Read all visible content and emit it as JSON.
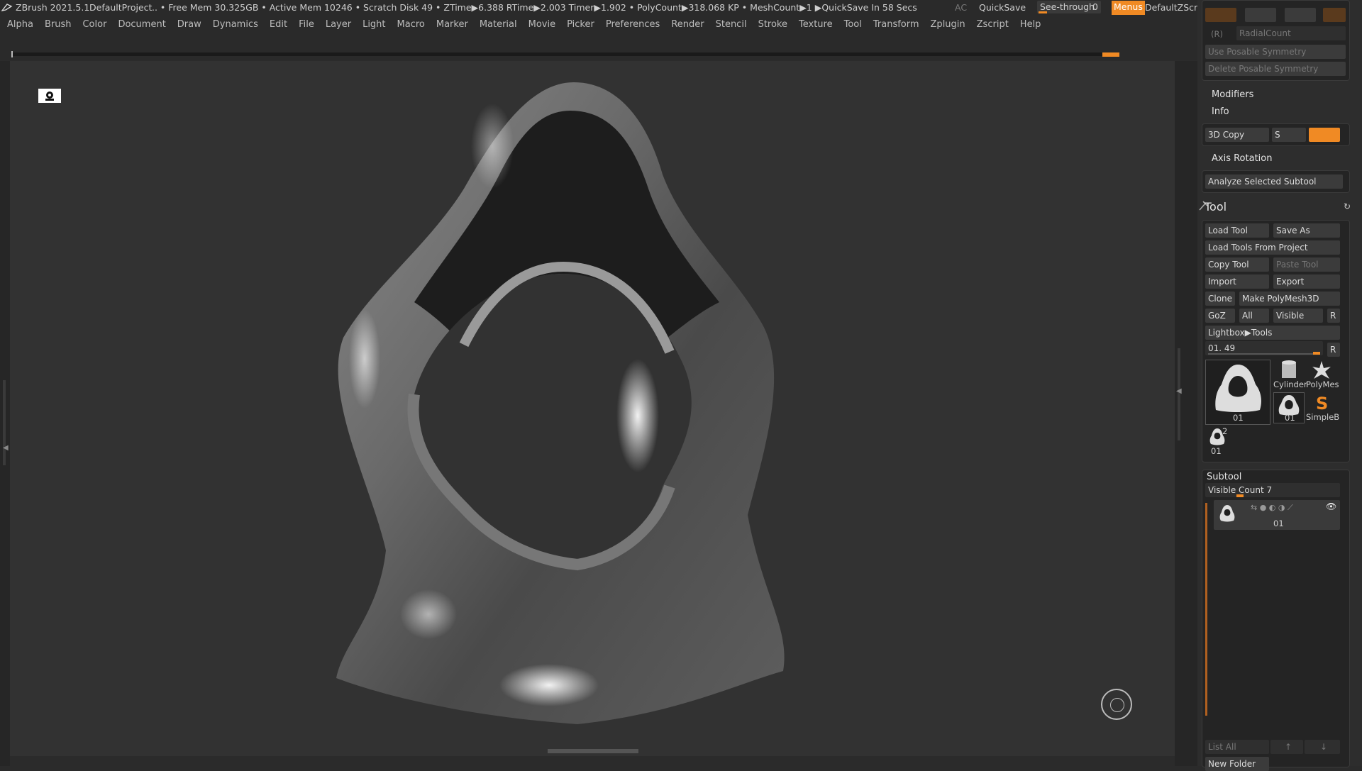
{
  "titlebar": {
    "app": "ZBrush 2021.5.1",
    "project": "DefaultProject",
    "stats": ".. • Free Mem 30.325GB • Active Mem 10246 • Scratch Disk 49 •  ZTime▶6.388 RTime▶2.003 Timer▶1.902 • PolyCount▶318.068 KP  • MeshCount▶1  ▶QuickSave In 58 Secs",
    "ac": "AC",
    "quicksave": "QuickSave",
    "seethrough": "See-through",
    "seethrough_value": "0",
    "menus": "Menus",
    "zscript": "DefaultZScript"
  },
  "menubar": {
    "items": [
      "Alpha",
      "Brush",
      "Color",
      "Document",
      "Draw",
      "Dynamics",
      "Edit",
      "File",
      "Layer",
      "Light",
      "Macro",
      "Marker",
      "Material",
      "Movie",
      "Picker",
      "Preferences",
      "Render",
      "Stencil",
      "Stroke",
      "Texture",
      "Tool",
      "Transform",
      "Zplugin",
      "Zscript",
      "Help"
    ]
  },
  "panel": {
    "r_label": "(R)",
    "radial_count": "RadialCount",
    "use_posable": "Use Posable Symmetry",
    "delete_posable": "Delete Posable Symmetry",
    "modifiers": "Modifiers",
    "info": "Info",
    "copy3d": "3D Copy",
    "copy3d_s": "S",
    "axis_rotation": "Axis Rotation",
    "analyze": "Analyze Selected Subtool",
    "tool_title": "Tool",
    "load_tool": "Load Tool",
    "save_as": "Save As",
    "load_from_project": "Load Tools From Project",
    "copy_tool": "Copy Tool",
    "paste_tool": "Paste Tool",
    "import": "Import",
    "export": "Export",
    "clone": "Clone",
    "make_polymesh": "Make PolyMesh3D",
    "goz": "GoZ",
    "all": "All",
    "visible": "Visible",
    "r": "R",
    "lightbox_tools": "Lightbox▶Tools",
    "tool_slider": "01. 49",
    "thumb_main": "01",
    "thumb_cylinder": "Cylinder",
    "thumb_polymesh": "PolyMes",
    "thumb_small": "01",
    "thumb_simpleb": "SimpleB",
    "thumb_two": "2",
    "thumb_last": "01",
    "subtool_title": "Subtool",
    "visible_count": "Visible Count 7",
    "subtool_name": "01",
    "list_all": "List All",
    "new_folder": "New Folder"
  },
  "colors": {
    "accent": "#f08a24",
    "background": "#323232",
    "panel": "#2d2d2d"
  }
}
